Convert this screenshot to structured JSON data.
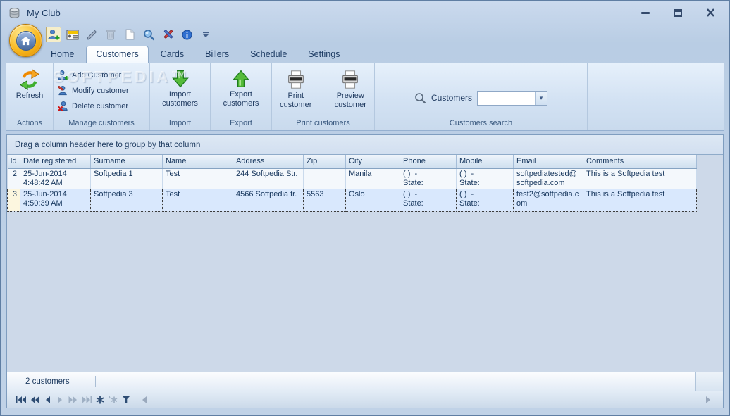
{
  "window": {
    "title": "My Club"
  },
  "watermark": "SOFTPEDIA™",
  "quick_access": {
    "icons": [
      "add-customer",
      "member-card",
      "edit-customer",
      "delete-customer",
      "new-record",
      "preview",
      "tools",
      "about"
    ]
  },
  "tabs": {
    "items": [
      "Home",
      "Customers",
      "Cards",
      "Billers",
      "Schedule",
      "Settings"
    ],
    "active": "Customers"
  },
  "ribbon": {
    "groups": [
      {
        "caption": "Actions"
      },
      {
        "caption": "Manage customers"
      },
      {
        "caption": "Import"
      },
      {
        "caption": "Export"
      },
      {
        "caption": "Print customers"
      },
      {
        "caption": "Customers search"
      }
    ],
    "buttons": {
      "refresh": "Refresh",
      "add_customer": "Add Customer",
      "modify_customer": "Modify customer",
      "delete_customer": "Delete customer",
      "import_customers": "Import\ncustomers",
      "export_customers": "Export\ncustomers",
      "print_customer": "Print\ncustomer",
      "preview_customer": "Preview\ncustomer"
    },
    "search": {
      "label": "Customers",
      "value": ""
    }
  },
  "grid": {
    "group_hint": "Drag a column header here to group by that column",
    "columns": [
      "Id",
      "Date registered",
      "Surname",
      "Name",
      "Address",
      "Zip",
      "City",
      "Phone",
      "Mobile",
      "Email",
      "Comments"
    ],
    "rows": [
      {
        "id": "2",
        "date": "25-Jun-2014\n4:48:42 AM",
        "surname": "Softpedia 1",
        "name": "Test",
        "address": "244 Softpedia Str.",
        "zip": "",
        "city": "Manila",
        "phone": "( )  -\nState:",
        "mobile": "( )  -\nState:",
        "email": "softpediatested@softpedia.com",
        "comments": "This is a Softpedia test"
      },
      {
        "id": "3",
        "date": "25-Jun-2014\n4:50:39 AM",
        "surname": "Softpedia 3",
        "name": "Test",
        "address": "4566 Softpedia tr.",
        "zip": "5563",
        "city": "Oslo",
        "phone": "( )  -\nState:",
        "mobile": "( )  -\nState:",
        "email": "test2@softpedia.com",
        "comments": "This is a Softpedia test"
      }
    ],
    "selected_row_id": "3"
  },
  "status": {
    "text": "2 customers"
  },
  "navigator": {
    "icons": [
      "first",
      "prior-page",
      "prior",
      "next",
      "next-page",
      "last",
      "insert",
      "edit",
      "filter"
    ]
  },
  "colors": {
    "title_text": "#1e3c64",
    "ribbon_text": "#1f3a60",
    "selection_bg": "#d9e8fd",
    "selection_indicator_bg": "#fcf6df",
    "grid_bg": "#cdd9e9"
  }
}
